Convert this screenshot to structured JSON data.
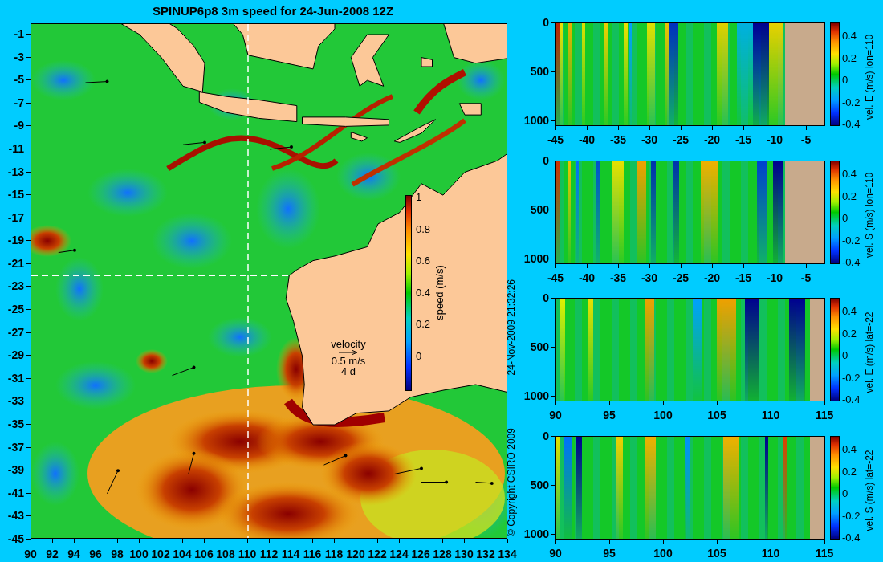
{
  "title": "SPINUP6p8 3m speed for 24-Jun-2008 12Z",
  "map": {
    "y_ticks": [
      "-1",
      "-3",
      "-5",
      "-7",
      "-9",
      "-11",
      "-13",
      "-15",
      "-17",
      "-19",
      "-21",
      "-23",
      "-25",
      "-27",
      "-29",
      "-31",
      "-33",
      "-35",
      "-37",
      "-39",
      "-41",
      "-43",
      "-45"
    ],
    "x_ticks": [
      "90",
      "92",
      "94",
      "96",
      "98",
      "100",
      "102",
      "104",
      "106",
      "108",
      "110",
      "112",
      "114",
      "116",
      "118",
      "120",
      "122",
      "124",
      "126",
      "128",
      "130",
      "132",
      "134"
    ],
    "colorbar": {
      "label": "speed (m/s)",
      "ticks": [
        "1",
        "0.8",
        "0.6",
        "0.4",
        "0.2",
        "0"
      ]
    },
    "velocity_legend": {
      "label": "velocity",
      "speed": "0.5 m/s",
      "duration": "4 d"
    }
  },
  "copyright": "© Copyright CSIRO 2009",
  "timestamp": "24-Nov-2009 21:32:26",
  "sections": [
    {
      "colorbar_label": "vel. E (m/s) lon=110",
      "y_ticks": [
        "0",
        "500",
        "1000"
      ],
      "x_ticks": [
        "-45",
        "-40",
        "-35",
        "-30",
        "-25",
        "-20",
        "-15",
        "-10",
        "-5"
      ],
      "colorbar_ticks": [
        "0.4",
        "0.2",
        "0",
        "-0.2",
        "-0.4"
      ]
    },
    {
      "colorbar_label": "vel. S (m/s) lon=110",
      "y_ticks": [
        "0",
        "500",
        "1000"
      ],
      "x_ticks": [
        "-45",
        "-40",
        "-35",
        "-30",
        "-25",
        "-20",
        "-15",
        "-10",
        "-5"
      ],
      "colorbar_ticks": [
        "0.4",
        "0.2",
        "0",
        "-0.2",
        "-0.4"
      ]
    },
    {
      "colorbar_label": "vel. E (m/s) lat=-22",
      "y_ticks": [
        "0",
        "500",
        "1000"
      ],
      "x_ticks": [
        "90",
        "95",
        "100",
        "105",
        "110",
        "115"
      ],
      "colorbar_ticks": [
        "0.4",
        "0.2",
        "0",
        "-0.2",
        "-0.4"
      ]
    },
    {
      "colorbar_label": "vel. S (m/s) lat=-22",
      "y_ticks": [
        "0",
        "500",
        "1000"
      ],
      "x_ticks": [
        "90",
        "95",
        "100",
        "105",
        "110",
        "115"
      ],
      "colorbar_ticks": [
        "0.4",
        "0.2",
        "0",
        "-0.2",
        "-0.4"
      ]
    }
  ]
}
